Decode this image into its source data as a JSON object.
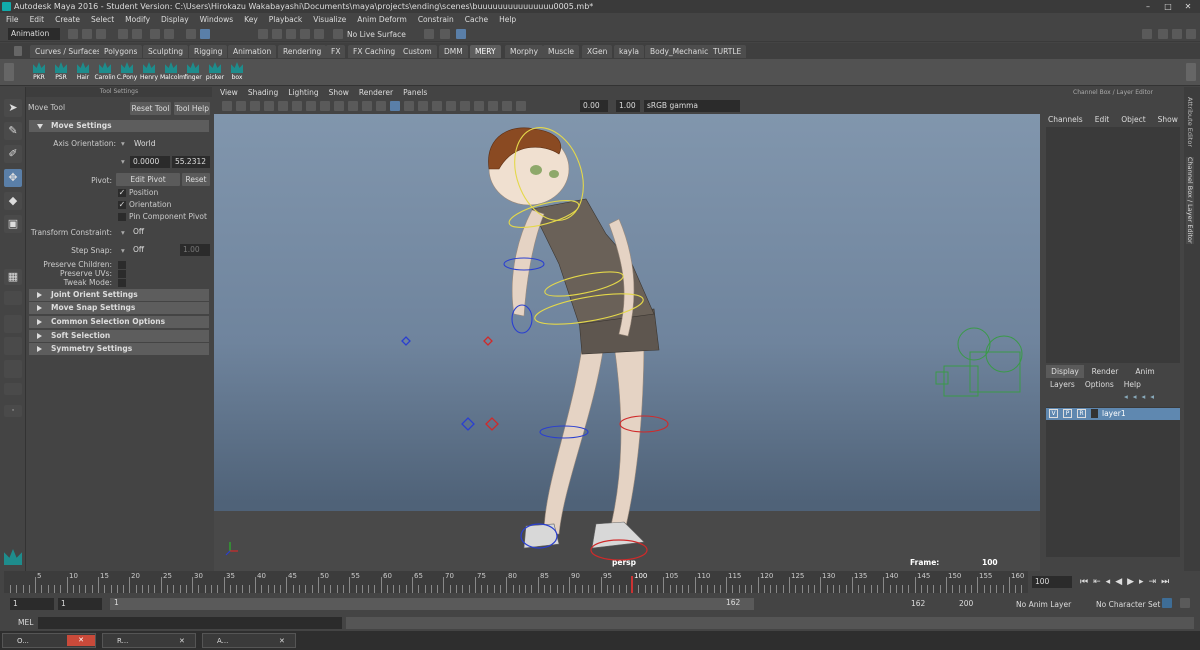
{
  "window": {
    "title": "Autodesk Maya 2016 - Student Version: C:\\Users\\Hirokazu Wakabayashi\\Documents\\maya\\projects\\ending\\scenes\\buuuuuuuuuuuuuuu0005.mb*"
  },
  "menu": [
    "File",
    "Edit",
    "Create",
    "Select",
    "Modify",
    "Display",
    "Windows",
    "Key",
    "Playback",
    "Visualize",
    "Anim Deform",
    "Constrain",
    "Cache",
    "Help"
  ],
  "status": {
    "mode": "Animation",
    "live_surface": "No Live Surface"
  },
  "shelf_tabs": [
    "Curves / Surfaces",
    "Polygons",
    "Sculpting",
    "Rigging",
    "Animation",
    "Rendering",
    "FX",
    "FX Caching",
    "Custom",
    "DMM",
    "MERY",
    "Morphy",
    "Muscle",
    "XGen",
    "kayla",
    "Body_Mechanic",
    "TURTLE"
  ],
  "shelf_active": "MERY",
  "shelf_buttons": [
    "PKR",
    "PSR",
    "Hair",
    "Carolin",
    "C.Pony",
    "Henry",
    "Malcolm",
    "finger",
    "picker",
    "box"
  ],
  "tool_settings": {
    "panel_title": "Tool Settings",
    "tool_name": "Move Tool",
    "reset_tool": "Reset Tool",
    "tool_help": "Tool Help",
    "move_settings": "Move Settings",
    "axis_orientation_label": "Axis Orientation:",
    "axis_orientation_value": "World",
    "coord_a": "0.0000",
    "coord_b": "55.2312",
    "pivot_label": "Pivot:",
    "edit_pivot": "Edit Pivot",
    "reset": "Reset",
    "position": "Position",
    "orientation": "Orientation",
    "pin_component_pivot": "Pin Component Pivot",
    "transform_constraint_label": "Transform Constraint:",
    "transform_constraint_value": "Off",
    "step_snap_label": "Step Snap:",
    "step_snap_value": "Off",
    "step_snap_num": "1.00",
    "preserve_children": "Preserve Children:",
    "preserve_uvs": "Preserve UVs:",
    "tweak_mode": "Tweak Mode:",
    "sections": [
      "Joint Orient Settings",
      "Move Snap Settings",
      "Common Selection Options",
      "Soft Selection",
      "Symmetry Settings"
    ]
  },
  "viewport": {
    "menu": [
      "View",
      "Shading",
      "Lighting",
      "Show",
      "Renderer",
      "Panels"
    ],
    "exposure": "0.00",
    "gamma": "1.00",
    "color_space": "sRGB gamma",
    "camera": "persp",
    "frame_label": "Frame:",
    "frame_value": "100"
  },
  "channel_box": {
    "title": "Channel Box / Layer Editor",
    "menu": [
      "Channels",
      "Edit",
      "Object",
      "Show"
    ],
    "layer_tabs": [
      "Display",
      "Render",
      "Anim"
    ],
    "layer_menu": [
      "Layers",
      "Options",
      "Help"
    ],
    "layer_flags": [
      "V",
      "P",
      "R"
    ],
    "layer_name": "layer1"
  },
  "side_tabs": [
    "Attribute Editor",
    "Channel Box / Layer Editor"
  ],
  "timeline": {
    "ticks": [
      "5",
      "10",
      "15",
      "20",
      "25",
      "30",
      "35",
      "40",
      "45",
      "50",
      "55",
      "60",
      "65",
      "70",
      "75",
      "80",
      "85",
      "90",
      "95",
      "100",
      "105",
      "110",
      "115",
      "120",
      "125",
      "130",
      "135",
      "140",
      "145",
      "150",
      "155",
      "160"
    ],
    "current": "100",
    "current_field": "100"
  },
  "range": {
    "start": "1",
    "start2": "1",
    "range_start": "1",
    "range_end": "162",
    "end": "162",
    "end2": "200",
    "anim_layer": "No Anim Layer",
    "character_set": "No Character Set"
  },
  "mel": {
    "label": "MEL"
  },
  "taskbar": [
    "O...",
    "R...",
    "A..."
  ]
}
